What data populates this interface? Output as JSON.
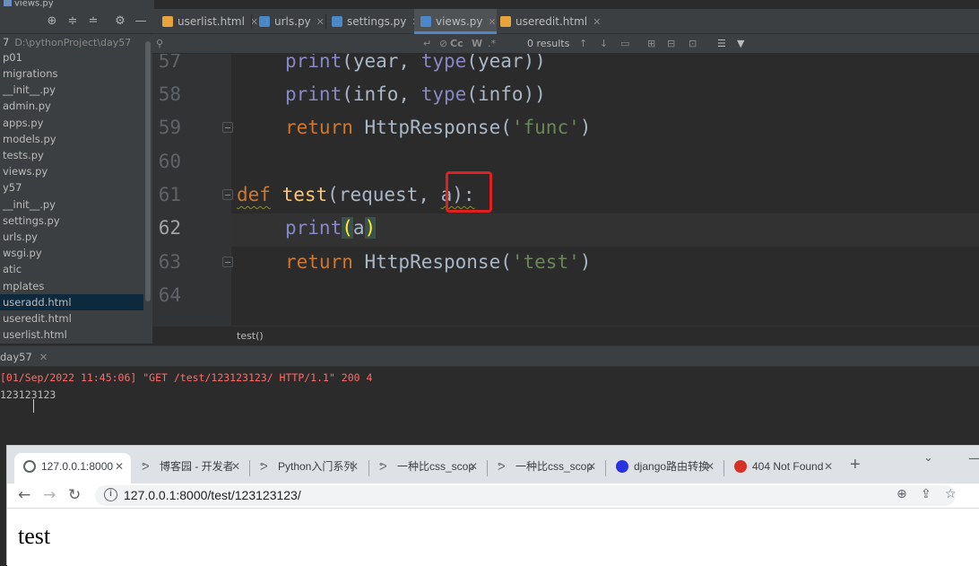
{
  "window": {
    "title_fragment": "views.py"
  },
  "project_tree": {
    "items": [
      {
        "label": "D:\\pythonProject\\day57",
        "prefix": "7",
        "kind": "root"
      },
      {
        "label": "p01",
        "kind": "folder"
      },
      {
        "label": "migrations",
        "kind": "folder"
      },
      {
        "label": "__init__.py",
        "kind": "file"
      },
      {
        "label": "admin.py",
        "kind": "file"
      },
      {
        "label": "apps.py",
        "kind": "file"
      },
      {
        "label": "models.py",
        "kind": "file"
      },
      {
        "label": "tests.py",
        "kind": "file"
      },
      {
        "label": "views.py",
        "kind": "file"
      },
      {
        "label": "y57",
        "kind": "folder"
      },
      {
        "label": "__init__.py",
        "kind": "file"
      },
      {
        "label": "settings.py",
        "kind": "file"
      },
      {
        "label": "urls.py",
        "kind": "file"
      },
      {
        "label": "wsgi.py",
        "kind": "file"
      },
      {
        "label": "atic",
        "kind": "folder"
      },
      {
        "label": "mplates",
        "kind": "folder"
      },
      {
        "label": "useradd.html",
        "kind": "file",
        "selected": true
      },
      {
        "label": "useredit.html",
        "kind": "file"
      },
      {
        "label": "userlist.html",
        "kind": "file"
      }
    ]
  },
  "editor_tabs": [
    {
      "label": "userlist.html",
      "icon_color": "#e8a33d",
      "active": false
    },
    {
      "label": "urls.py",
      "icon_color": "#4a88c7",
      "active": false
    },
    {
      "label": "settings.py",
      "icon_color": "#4a88c7",
      "active": false
    },
    {
      "label": "views.py",
      "icon_color": "#4a88c7",
      "active": true
    },
    {
      "label": "useredit.html",
      "icon_color": "#e8a33d",
      "active": false
    }
  ],
  "find_bar": {
    "results": "0 results",
    "match_case": "Cc",
    "words": "W"
  },
  "code": {
    "line_numbers": [
      "57",
      "58",
      "59",
      "60",
      "61",
      "62",
      "63",
      "64"
    ],
    "current_line": "62"
  },
  "breadcrumb": "test()",
  "run_panel": {
    "tab_label": "day57",
    "console_line1": "[01/Sep/2022 11:45:06] \"GET /test/123123123/ HTTP/1.1\" 200 4",
    "console_line2": "123123123"
  },
  "browser": {
    "tabs": [
      {
        "label": "127.0.0.1:8000",
        "icon_color": "#5f6368",
        "active": true
      },
      {
        "label": "博客园 - 开发者",
        "icon_color": "#5f6368",
        "active": false
      },
      {
        "label": "Python入门系列",
        "icon_color": "#5f6368",
        "active": false
      },
      {
        "label": "一种比css_scop",
        "icon_color": "#5f6368",
        "active": false
      },
      {
        "label": "一种比css_scop",
        "icon_color": "#5f6368",
        "active": false
      },
      {
        "label": "django路由转换",
        "icon_color": "#2932e1",
        "active": false
      },
      {
        "label": "404 Not Found",
        "icon_color": "#d93025",
        "active": false
      }
    ],
    "url": "127.0.0.1:8000/test/123123123/",
    "page_text": "test"
  },
  "colors": {
    "highlight_box": "#e02020",
    "selection": "#0d293e",
    "tab_underline": "#4a88c7"
  }
}
